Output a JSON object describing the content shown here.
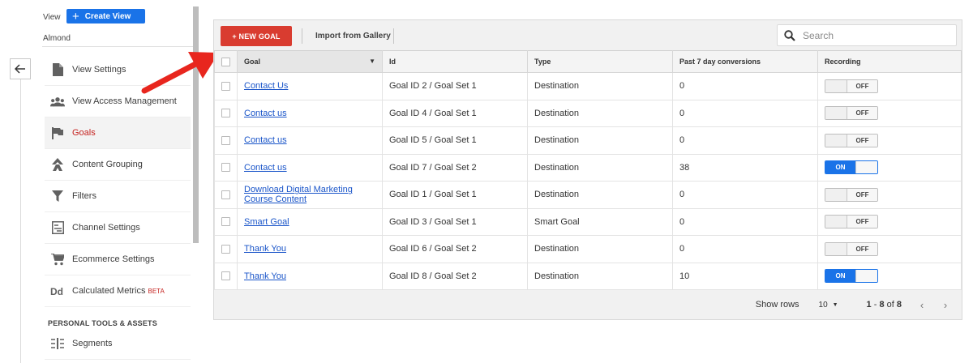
{
  "sidebar": {
    "view_label": "View",
    "create_view_label": "Create View",
    "view_name": "Almond",
    "items": [
      {
        "label": "View Settings",
        "icon": "document-icon"
      },
      {
        "label": "View Access Management",
        "icon": "people-icon"
      },
      {
        "label": "Goals",
        "icon": "flag-icon",
        "active": true
      },
      {
        "label": "Content Grouping",
        "icon": "person-walk-icon"
      },
      {
        "label": "Filters",
        "icon": "filter-icon"
      },
      {
        "label": "Channel Settings",
        "icon": "channel-icon"
      },
      {
        "label": "Ecommerce Settings",
        "icon": "cart-icon"
      },
      {
        "label": "Calculated Metrics",
        "badge": "BETA",
        "icon": "dd-icon"
      },
      {
        "label": "Segments",
        "icon": "segments-icon"
      }
    ],
    "section_heading": "PERSONAL TOOLS & ASSETS"
  },
  "toolbar": {
    "new_goal_label": "+ NEW GOAL",
    "import_label": "Import from Gallery",
    "search_placeholder": "Search"
  },
  "table": {
    "headers": [
      "Goal",
      "Id",
      "Type",
      "Past 7 day conversions",
      "Recording"
    ],
    "rows": [
      {
        "goal": "Contact Us",
        "id": "Goal ID 2 / Goal Set 1",
        "type": "Destination",
        "conversions": "0",
        "recording": "OFF"
      },
      {
        "goal": "Contact us",
        "id": "Goal ID 4 / Goal Set 1",
        "type": "Destination",
        "conversions": "0",
        "recording": "OFF"
      },
      {
        "goal": "Contact us",
        "id": "Goal ID 5 / Goal Set 1",
        "type": "Destination",
        "conversions": "0",
        "recording": "OFF"
      },
      {
        "goal": "Contact us",
        "id": "Goal ID 7 / Goal Set 2",
        "type": "Destination",
        "conversions": "38",
        "recording": "ON"
      },
      {
        "goal": "Download Digital Marketing Course Content",
        "id": "Goal ID 1 / Goal Set 1",
        "type": "Destination",
        "conversions": "0",
        "recording": "OFF"
      },
      {
        "goal": "Smart Goal",
        "id": "Goal ID 3 / Goal Set 1",
        "type": "Smart Goal",
        "conversions": "0",
        "recording": "OFF"
      },
      {
        "goal": "Thank You",
        "id": "Goal ID 6 / Goal Set 2",
        "type": "Destination",
        "conversions": "0",
        "recording": "OFF"
      },
      {
        "goal": "Thank You",
        "id": "Goal ID 8 / Goal Set 2",
        "type": "Destination",
        "conversions": "10",
        "recording": "ON"
      }
    ]
  },
  "footer": {
    "show_rows_label": "Show rows",
    "rows_value": "10",
    "range_start": "1",
    "range_sep": " - ",
    "range_end": "8",
    "range_of": " of ",
    "range_total": "8"
  },
  "colors": {
    "accent": "#1a73e8",
    "new_goal": "#d93c30",
    "active_nav": "#c5221f",
    "link": "#1a55c9",
    "annotation_arrow": "#e8261e"
  }
}
